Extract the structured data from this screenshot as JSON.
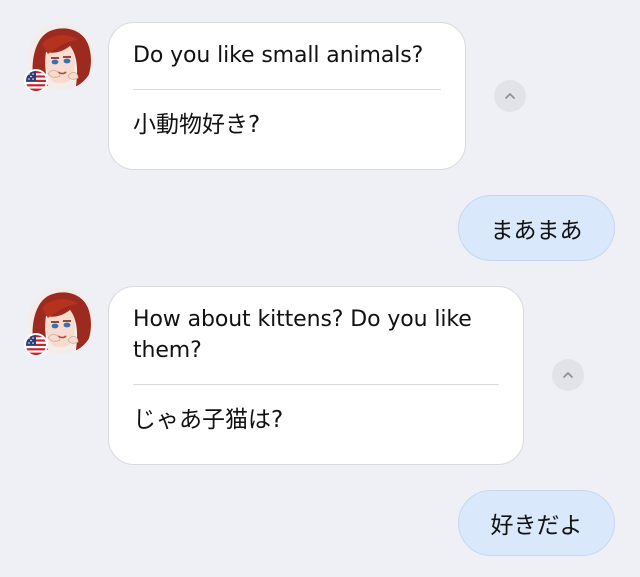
{
  "messages": [
    {
      "sender": "bot",
      "english": "Do you like small animals?",
      "japanese": "小動物好き?",
      "avatar_icon": "anime-girl-avatar-icon",
      "flag_icon": "us-flag-icon"
    },
    {
      "sender": "user",
      "text": "まあまあ"
    },
    {
      "sender": "bot",
      "english": "How about kittens? Do you like them?",
      "japanese": "じゃあ子猫は?",
      "avatar_icon": "anime-girl-avatar-icon",
      "flag_icon": "us-flag-icon"
    },
    {
      "sender": "user",
      "text": "好きだよ"
    }
  ],
  "colors": {
    "background": "#eff0f5",
    "bot_bubble": "#ffffff",
    "user_bubble": "#d9e8fb",
    "collapse_button": "#e2e3e8"
  }
}
